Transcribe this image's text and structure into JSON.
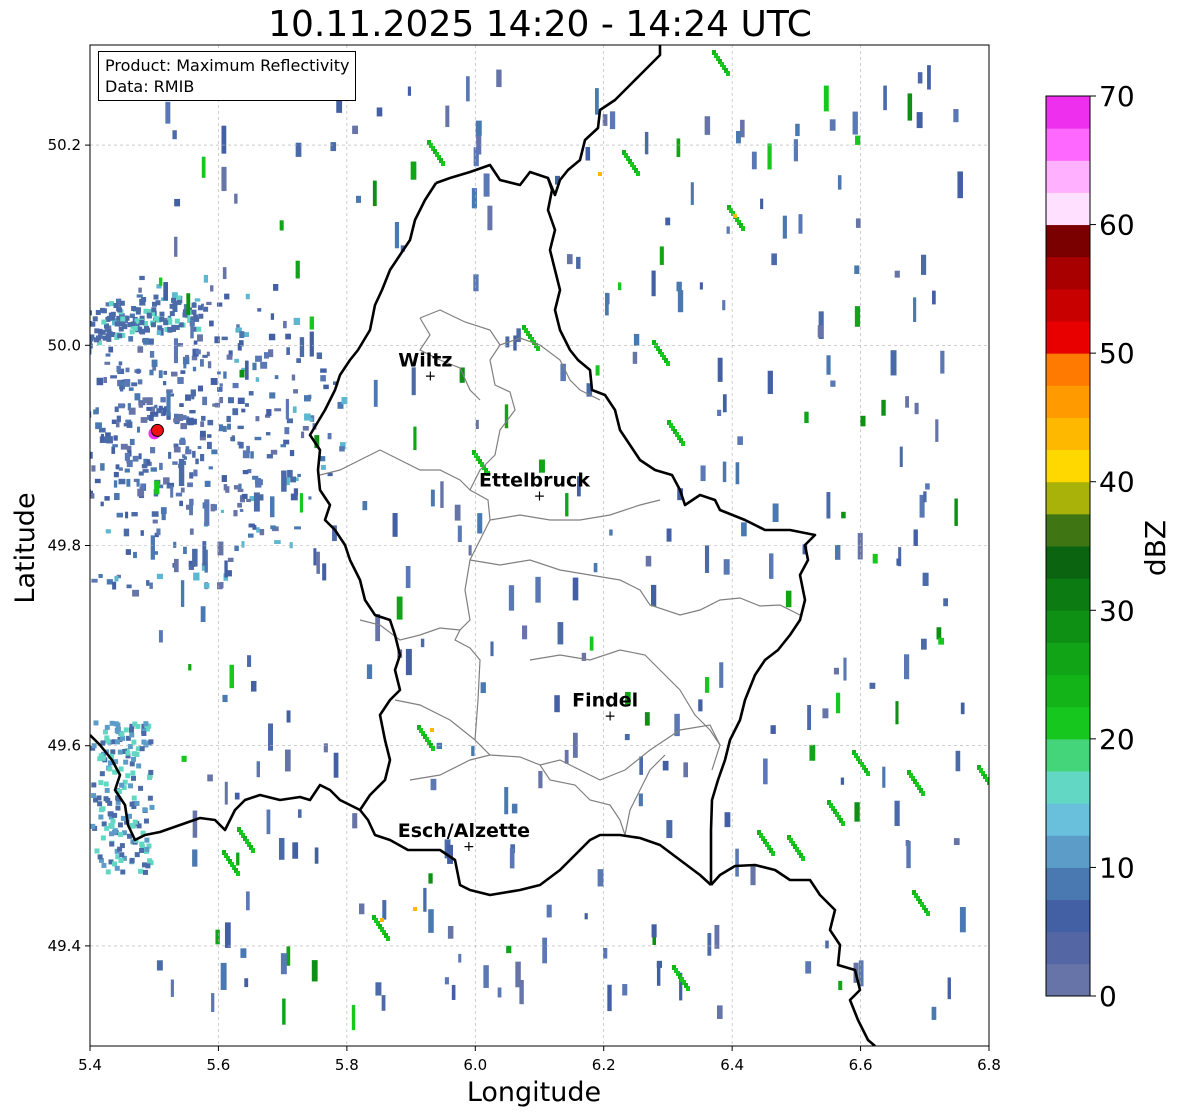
{
  "title": "10.11.2025 14:20 - 14:24 UTC",
  "info": {
    "product": "Product: Maximum Reflectivity",
    "data": "Data: RMIB"
  },
  "axes": {
    "xlabel": "Longitude",
    "ylabel": "Latitude",
    "xticks": [
      "5.4",
      "5.6",
      "5.8",
      "6.0",
      "6.2",
      "6.4",
      "6.6",
      "6.8"
    ],
    "yticks": [
      "49.4",
      "49.6",
      "49.8",
      "50.0",
      "50.2"
    ],
    "xlim": [
      5.4,
      6.8
    ],
    "ylim": [
      49.3,
      50.3
    ],
    "grid": true
  },
  "colorbar": {
    "label": "dBZ",
    "ticks": [
      "0",
      "10",
      "20",
      "30",
      "40",
      "50",
      "60",
      "70"
    ],
    "range": [
      0,
      70
    ],
    "colors": [
      "#6674a8",
      "#5566a4",
      "#4460a5",
      "#4a78b0",
      "#5c9cc8",
      "#68c0dc",
      "#62d8c4",
      "#44d47a",
      "#16c81e",
      "#12b418",
      "#10a416",
      "#0e9014",
      "#0c7c12",
      "#0a6410",
      "#3f7512",
      "#a8b208",
      "#ffd800",
      "#ffb800",
      "#ff9a00",
      "#ff7a00",
      "#e80000",
      "#c80000",
      "#a80000",
      "#7a0000",
      "#ffe0ff",
      "#ffb0ff",
      "#ff68ff",
      "#ee30ee"
    ]
  },
  "places": [
    {
      "name": "Wiltz",
      "lon": 5.93,
      "lat": 49.97
    },
    {
      "name": "Ettelbruck",
      "lon": 6.1,
      "lat": 49.85
    },
    {
      "name": "Findel",
      "lon": 6.21,
      "lat": 49.63
    },
    {
      "name": "Esch/Alzette",
      "lon": 5.99,
      "lat": 49.5
    }
  ],
  "radar_site": {
    "lon": 5.505,
    "lat": 49.915
  },
  "colors": {
    "border": "#000000",
    "canton": "#808080",
    "grid": "#b0b0b0"
  }
}
